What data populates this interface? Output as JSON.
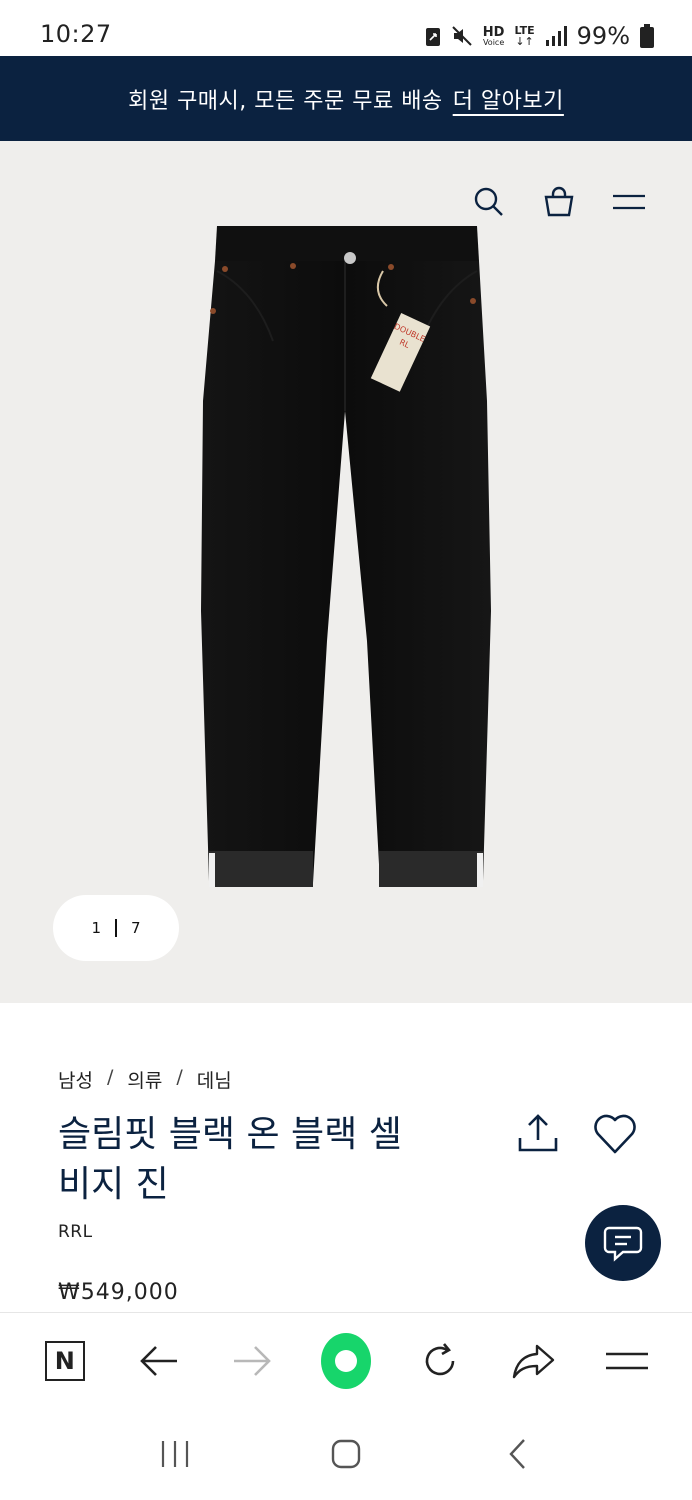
{
  "status_bar": {
    "time": "10:27",
    "battery": "99%",
    "indicators": [
      "nfc-icon",
      "mute-icon",
      "hd-voice-icon",
      "lte-icon",
      "signal-icon",
      "battery-icon"
    ],
    "hd_label": "HD",
    "voice_label": "Voice",
    "lte_label": "LTE"
  },
  "promo": {
    "text": "회원 구매시, 모든 주문 무료 배송",
    "link": "더 알아보기",
    "background": "#0b2240"
  },
  "hero": {
    "icons": [
      "search-icon",
      "shopping-bag-icon",
      "menu-icon"
    ],
    "pager_current": "1",
    "pager_total": "7",
    "background": "#efeeec"
  },
  "product": {
    "breadcrumb": [
      "남성",
      "의류",
      "데님"
    ],
    "title_line1": "슬림핏 블랙 온 블랙 셀",
    "title_line2": "비지 진",
    "brand": "RRL",
    "price": "₩549,000"
  },
  "browser_toolbar": {
    "buttons": [
      "naver-home-icon",
      "back-arrow-icon",
      "forward-arrow-icon",
      "green-dot-button",
      "refresh-icon",
      "share-arrow-icon",
      "hamburger-menu-icon"
    ],
    "home_label": "N",
    "accent": "#17d56b"
  },
  "nav_bar": {
    "buttons": [
      "recent-apps-icon",
      "home-icon",
      "back-icon"
    ]
  }
}
